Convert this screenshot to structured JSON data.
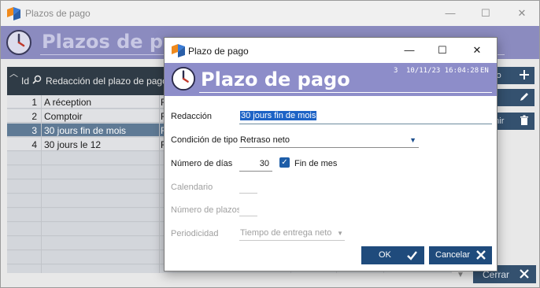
{
  "back_window": {
    "title": "Plazos de pago",
    "header_title": "Plazos de pago",
    "controls": {
      "minimize": "—",
      "maximize": "☐",
      "close": "✕"
    },
    "grid": {
      "col_id": "Id",
      "col_redaction": "Redacción del plazo de pago",
      "rows": [
        {
          "id": "1",
          "text": "A réception",
          "r": "R"
        },
        {
          "id": "2",
          "text": "Comptoir",
          "r": "R"
        },
        {
          "id": "3",
          "text": "30 jours fin de mois",
          "r": "R"
        },
        {
          "id": "4",
          "text": "30 jours le 12",
          "r": "R"
        }
      ]
    },
    "side_buttons": {
      "new": "evo",
      "edit": "tar",
      "delete": "rimir"
    },
    "close_label": "Cerrar"
  },
  "dialog": {
    "title": "Plazo de pago",
    "header_title": "Plazo de pago",
    "meta_count": "3",
    "meta_datetime": "10/11/23 16:04:28",
    "meta_lang": "EN",
    "controls": {
      "minimize": "—",
      "maximize": "☐",
      "close": "✕"
    },
    "fields": {
      "redaccion_label": "Redacción",
      "redaccion_value": "30 jours fin de mois",
      "condicion_label": "Condición de tipo",
      "condicion_value": "Retraso neto",
      "dias_label": "Número de días",
      "dias_value": "30",
      "fin_de_mes_label": "Fin de mes",
      "calendario_label": "Calendario",
      "plazos_label": "Número de plazos",
      "periodicidad_label": "Periodicidad",
      "periodicidad_value": "Tiempo de entrega neto"
    },
    "ok_label": "OK",
    "cancel_label": "Cancelar"
  },
  "colors": {
    "header_purple": "#8d8dc9",
    "button_blue": "#1f4b7c",
    "grid_header": "#2f3b46",
    "selection": "#5f7a95",
    "highlight": "#1d63c6"
  }
}
